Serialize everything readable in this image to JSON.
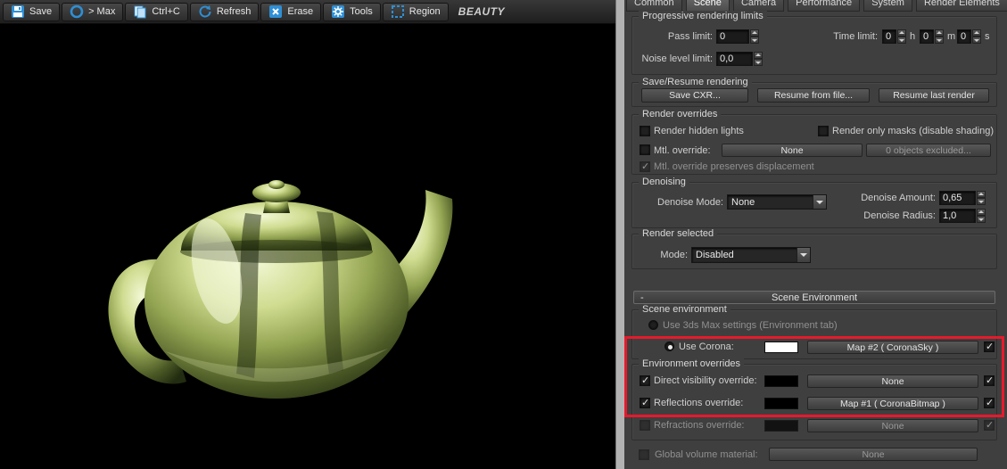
{
  "vfb": {
    "toolbar": {
      "save": "Save",
      "to_max": "> Max",
      "copy": "Ctrl+C",
      "refresh": "Refresh",
      "erase": "Erase",
      "tools": "Tools",
      "region": "Region",
      "channel": "BEAUTY"
    },
    "icons": {
      "save": "floppy-disk",
      "to_max": "corona-ring",
      "copy": "copy-pages",
      "refresh": "circular-arrow",
      "erase": "x-cross",
      "tools": "gear",
      "region": "dashed-rectangle"
    }
  },
  "tabs": {
    "items": [
      {
        "label": "Common",
        "active": false
      },
      {
        "label": "Scene",
        "active": true
      },
      {
        "label": "Camera",
        "active": false
      },
      {
        "label": "Performance",
        "active": false
      },
      {
        "label": "System",
        "active": false
      },
      {
        "label": "Render Elements",
        "active": false
      }
    ]
  },
  "progressive": {
    "title": "Progressive rendering limits",
    "pass_limit": {
      "label": "Pass limit:",
      "value": "0"
    },
    "time_limit": {
      "label": "Time limit:",
      "h": "0",
      "h_unit": "h",
      "m": "0",
      "m_unit": "m",
      "s": "0",
      "s_unit": "s"
    },
    "noise": {
      "label": "Noise level limit:",
      "value": "0,0"
    }
  },
  "save_resume": {
    "title": "Save/Resume rendering",
    "save_cxr": "Save CXR...",
    "resume_file": "Resume from file...",
    "resume_last": "Resume last render"
  },
  "render_overrides": {
    "title": "Render overrides",
    "hidden_lights": "Render hidden lights",
    "only_masks": "Render only masks (disable shading)",
    "mtl_override": "Mtl. override:",
    "mtl_value": "None",
    "excluded": "0 objects excluded...",
    "preserve_disp": "Mtl. override preserves displacement"
  },
  "denoising": {
    "title": "Denoising",
    "mode_label": "Denoise Mode:",
    "mode_value": "None",
    "amount_label": "Denoise Amount:",
    "amount_value": "0,65",
    "radius_label": "Denoise Radius:",
    "radius_value": "1,0"
  },
  "render_selected": {
    "title": "Render selected",
    "mode_label": "Mode:",
    "mode_value": "Disabled"
  },
  "scene_env": {
    "collapse_glyph": "-",
    "rollout_title": "Scene Environment",
    "group_title": "Scene environment",
    "use_max": "Use 3ds Max settings (Environment tab)",
    "use_corona": "Use Corona:",
    "corona_map": "Map #2  ( CoronaSky )",
    "swatch_color": "#ffffff"
  },
  "env_overrides": {
    "title": "Environment overrides",
    "rows": [
      {
        "label": "Direct visibility override:",
        "map": "None",
        "swatch": "#000000"
      },
      {
        "label": "Reflections override:",
        "map": "Map #1 ( CoronaBitmap )",
        "swatch": "#000000"
      },
      {
        "label": "Refractions override:",
        "map": "None",
        "swatch": "#000000"
      }
    ]
  },
  "global_volume": {
    "label": "Global volume material:",
    "value": "None"
  },
  "annotation": {
    "color": "#e8192c"
  }
}
